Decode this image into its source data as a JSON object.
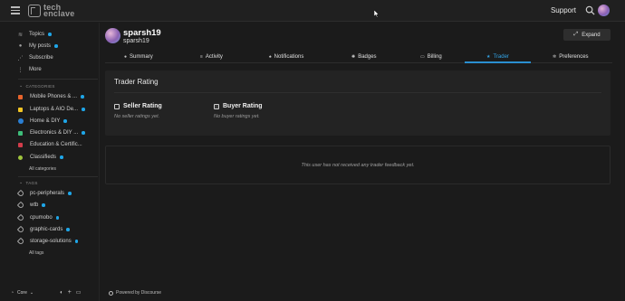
{
  "header": {
    "logo_line1": "tech",
    "logo_line2": "enclave",
    "support_label": "Support"
  },
  "sidebar": {
    "main_items": [
      {
        "label": "Topics",
        "icon": "layers-icon",
        "unread": true
      },
      {
        "label": "My posts",
        "icon": "user-icon",
        "unread": true
      },
      {
        "label": "Subscribe",
        "icon": "rss-icon",
        "unread": false
      },
      {
        "label": "More",
        "icon": "ellipsis-icon",
        "unread": false
      }
    ],
    "categories_heading": "CATEGORIES",
    "categories": [
      {
        "label": "Mobile Phones & ...",
        "color": "#e8642c",
        "unread": true
      },
      {
        "label": "Laptops & AIO De...",
        "color": "#f2c524",
        "unread": true
      },
      {
        "label": "Home & DIY",
        "color": "#2a7fd4",
        "unread": true
      },
      {
        "label": "Electronics & DIY ...",
        "color": "#3ebd7a",
        "unread": true
      },
      {
        "label": "Education & Certific...",
        "color": "#d23c4a",
        "unread": false
      },
      {
        "label": "Classifieds",
        "color": "#9fc43d",
        "unread": true
      }
    ],
    "all_categories": "All categories",
    "tags_heading": "TAGS",
    "tags": [
      {
        "label": "pc-peripherals",
        "unread": true
      },
      {
        "label": "wtb",
        "unread": true
      },
      {
        "label": "cpumobo",
        "unread": true
      },
      {
        "label": "graphic-cards",
        "unread": true
      },
      {
        "label": "storage-solutions",
        "unread": true
      }
    ],
    "all_tags": "All tags",
    "footer_theme": "Core"
  },
  "profile": {
    "username": "sparsh19",
    "subname": "sparsh19",
    "expand_label": "Expand"
  },
  "tabs": [
    {
      "label": "Summary",
      "icon": "user-icon",
      "active": false
    },
    {
      "label": "Activity",
      "icon": "bars-icon",
      "active": false
    },
    {
      "label": "Notifications",
      "icon": "bell-icon",
      "active": false
    },
    {
      "label": "Badges",
      "icon": "certificate-icon",
      "active": false
    },
    {
      "label": "Billing",
      "icon": "credit-card-icon",
      "active": false
    },
    {
      "label": "Trader",
      "icon": "star-icon",
      "active": true
    },
    {
      "label": "Preferences",
      "icon": "gear-icon",
      "active": false
    }
  ],
  "trader": {
    "title": "Trader Rating",
    "seller_heading": "Seller Rating",
    "seller_empty": "No seller ratings yet.",
    "buyer_heading": "Buyer Rating",
    "buyer_empty": "No buyer ratings yet.",
    "feedback_empty": "This user has not received any trader feedback yet."
  },
  "footer": {
    "powered_by": "Powered by Discourse"
  },
  "colors": {
    "accent": "#33a5e8",
    "unread_dot": "#1fa6e8",
    "background": "#1b1b1b",
    "panel": "#232323"
  }
}
